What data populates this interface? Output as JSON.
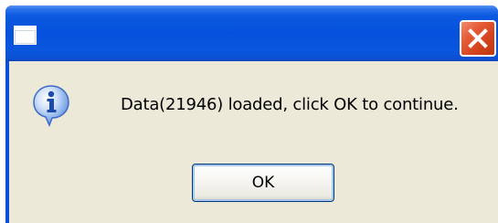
{
  "dialog": {
    "title": "",
    "message": "Data(21946) loaded, click OK to continue.",
    "ok_label": "OK",
    "icon": "info-icon",
    "close_icon": "close-icon"
  },
  "colors": {
    "titlebar": "#0551dc",
    "client_bg": "#ece9d8",
    "close_button": "#d0411b"
  }
}
